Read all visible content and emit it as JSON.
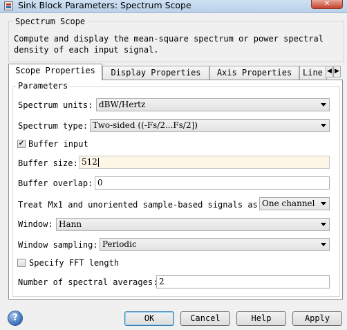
{
  "window": {
    "title": "Sink Block Parameters: Spectrum Scope",
    "close_glyph": "✕"
  },
  "block": {
    "name": "Spectrum Scope",
    "description": "Compute and display the mean-square spectrum or power spectral density of each input signal."
  },
  "tabs": [
    {
      "label": "Scope Properties",
      "active": true
    },
    {
      "label": "Display Properties",
      "active": false
    },
    {
      "label": "Axis Properties",
      "active": false
    },
    {
      "label": "Line",
      "active": false
    }
  ],
  "tab_scroll": {
    "left": "◀",
    "right": "▶"
  },
  "parameters": {
    "group_label": "Parameters",
    "spectrum_units": {
      "label": "Spectrum units:",
      "value": "dBW/Hertz"
    },
    "spectrum_type": {
      "label": "Spectrum type:",
      "value": "Two-sided ((-Fs/2...Fs/2])"
    },
    "buffer_input": {
      "label": "Buffer input",
      "checked": true,
      "mark": "✔"
    },
    "buffer_size": {
      "label": "Buffer size:",
      "value": "512"
    },
    "buffer_overlap": {
      "label": "Buffer overlap:",
      "value": "0"
    },
    "treat_mx1": {
      "label": "Treat Mx1 and unoriented sample-based signals as:",
      "value": "One channel"
    },
    "window": {
      "label": "Window:",
      "value": "Hann"
    },
    "window_sampling": {
      "label": "Window sampling:",
      "value": "Periodic"
    },
    "specify_fft": {
      "label": "Specify FFT length",
      "checked": false,
      "mark": ""
    },
    "num_averages": {
      "label": "Number of spectral averages:",
      "value": "2"
    }
  },
  "footer": {
    "help_glyph": "?",
    "ok": "OK",
    "cancel": "Cancel",
    "help": "Help",
    "apply": "Apply"
  }
}
